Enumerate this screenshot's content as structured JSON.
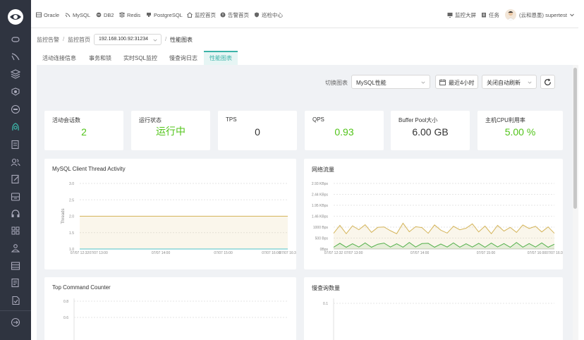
{
  "topbar": {
    "nav": [
      {
        "label": "Oracle",
        "icon": "database-icon"
      },
      {
        "label": "MySQL",
        "icon": "dolphin-icon"
      },
      {
        "label": "DB2",
        "icon": "db2-icon"
      },
      {
        "label": "Redis",
        "icon": "redis-icon"
      },
      {
        "label": "PostgreSQL",
        "icon": "elephant-icon"
      },
      {
        "label": "监控首页",
        "icon": "home-icon"
      },
      {
        "label": "告警首页",
        "icon": "alert-icon"
      },
      {
        "label": "巡检中心",
        "icon": "shield-icon"
      }
    ],
    "right": {
      "dashboard": "监控大屏",
      "tasks": "任务",
      "user": "(云和恩墨) supertest"
    }
  },
  "breadcrumb": {
    "items": [
      "监控告警",
      "监控首页"
    ],
    "ip": "192.168.100.92:31234",
    "page": "性能图表",
    "sep": "/"
  },
  "tabs": [
    "活动连接信息",
    "事务和锁",
    "实时SQL监控",
    "慢查询日志",
    "性能图表"
  ],
  "active_tab": 4,
  "toolbar": {
    "switch_label": "切换图表",
    "chart_select": "MySQL性能",
    "time_range": "最近4小时",
    "refresh": "关闭自动刷新"
  },
  "stats": [
    {
      "title": "活动会话数",
      "value": "2",
      "color": "green"
    },
    {
      "title": "运行状态",
      "value": "运行中",
      "color": "green"
    },
    {
      "title": "TPS",
      "value": "0",
      "color": "dark"
    },
    {
      "title": "QPS",
      "value": "0.93",
      "color": "green"
    },
    {
      "title": "Buffer Pool大小",
      "value": "6.00 GB",
      "color": "dark"
    },
    {
      "title": "主机CPU利用率",
      "value": "5.00 %",
      "color": "green"
    }
  ],
  "chart_data": [
    {
      "type": "area",
      "title": "MySQL Client Thread Activity",
      "ylabel": "Threads",
      "yticks": [
        "3.0",
        "2.5",
        "2.0",
        "1.5",
        "1.0"
      ],
      "ylim": [
        1.0,
        3.0
      ],
      "xticks": [
        "07/07 12:32",
        "07/07 13:00",
        "07/07 14:00",
        "07/07 15:00",
        "07/07 16:00",
        "07/07 16:3"
      ],
      "series": [
        {
          "values": [
            2,
            2,
            2,
            2,
            2,
            2,
            2,
            2
          ],
          "color": "#d4b45a"
        },
        {
          "values": [
            1,
            1,
            1,
            1,
            1,
            1,
            1,
            1
          ],
          "color": "#4fc3c8"
        }
      ]
    },
    {
      "type": "area",
      "title": "网络流量",
      "yticks": [
        "2.93 KBps",
        "2.44 KBps",
        "1.95 KBps",
        "1.46 KBps",
        "1000 Bps",
        "500 Bps",
        "0Bps"
      ],
      "ylim": [
        0,
        3000
      ],
      "xticks": [
        "07/07 12:32",
        "07/07 13:00",
        "07/07 14:00",
        "07/07 15:00",
        "07/07 16:00",
        "07/07 16:3"
      ],
      "series": [
        {
          "values": [
            720,
            1080,
            700,
            1060,
            880,
            1110,
            760,
            990,
            1010,
            840,
            700,
            1180,
            790,
            1020,
            980,
            720,
            1100,
            860,
            730,
            1040,
            880,
            950,
            1150,
            780,
            1050,
            700,
            1080,
            820,
            990,
            760,
            1100,
            940,
            1040,
            780,
            1010,
            720
          ],
          "color": "#d4b45a"
        },
        {
          "values": [
            80,
            260,
            80,
            240,
            90,
            280,
            80,
            220,
            270,
            90,
            240,
            85,
            300,
            90,
            250,
            260,
            80,
            230,
            90,
            280,
            85,
            240,
            90,
            260,
            80,
            270,
            95,
            250,
            80,
            300,
            85,
            250,
            90,
            280,
            80,
            220
          ],
          "color": "#52b04a"
        }
      ]
    },
    {
      "type": "line",
      "title": "Top Command Counter",
      "yticks": [
        "0.8",
        "0.6"
      ],
      "series": []
    },
    {
      "type": "line",
      "title": "慢查询数量",
      "yticks": [
        "0.1"
      ],
      "series": []
    }
  ]
}
